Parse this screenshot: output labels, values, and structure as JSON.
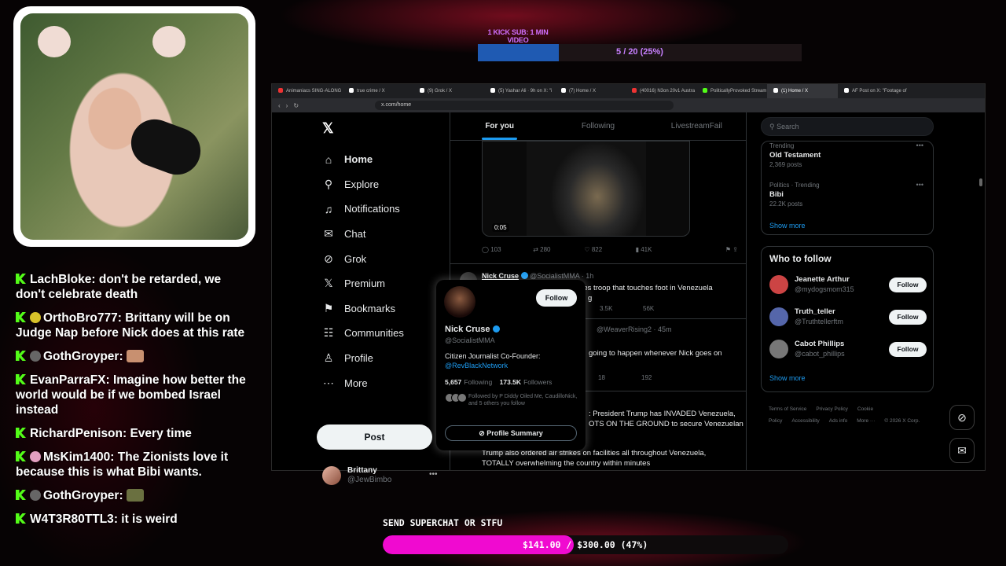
{
  "stream": {
    "subgoal": {
      "label": "1 KICK SUB: 1 MIN VIDEO",
      "progress_text": "5 / 20 (25%)",
      "progress": 0.25
    },
    "superchat": {
      "label": "SEND SUPERCHAT OR STFU",
      "progress_text": "$141.00 / $300.00 (47%)",
      "progress": 0.47
    }
  },
  "chat": [
    {
      "user": "LachBloke",
      "text": ": don't be retarded, we don't celebrate death",
      "badge": ""
    },
    {
      "user": "OrthoBro777",
      "text": ": Brittany will be on Judge Nap before Nick does at this rate",
      "badge": "#d8c22a"
    },
    {
      "user": "GothGroyper",
      "text": ":",
      "badge": "#666",
      "emote": "#c89070"
    },
    {
      "user": "EvanParraFX",
      "text": ": Imagine how better the world would be if we bombed Israel instead",
      "badge": ""
    },
    {
      "user": "RichardPenison",
      "text": ": Every time",
      "badge": ""
    },
    {
      "user": "MsKim1400",
      "text": ": The Zionists love it because this is what Bibi wants.",
      "badge": "#e2a0c0"
    },
    {
      "user": "GothGroyper",
      "text": ":",
      "badge": "#666",
      "emote": "#6a7040"
    },
    {
      "user": "W4T3R80TTL3",
      "text": ": it is weird",
      "badge": ""
    }
  ],
  "browser": {
    "tabs": [
      {
        "title": "Animaniacs SING-ALONG",
        "color": "#e33"
      },
      {
        "title": "true crime / X",
        "color": "#fff"
      },
      {
        "title": "(9) Grok / X",
        "color": "#fff"
      },
      {
        "title": "(5) Yashar Ali · 9h on X: \"i",
        "color": "#fff"
      },
      {
        "title": "(7) Home / X",
        "color": "#fff"
      },
      {
        "title": "(40016) N3on 20v1 Austra",
        "color": "#e33"
      },
      {
        "title": "PoliticallyProvoked Stream",
        "color": "#53fc18"
      },
      {
        "title": "(1) Home / X",
        "color": "#fff",
        "active": true
      },
      {
        "title": "AF Post on X: \"Footage of",
        "color": "#fff"
      }
    ],
    "url": "x.com/home"
  },
  "x": {
    "nav": [
      {
        "label": "Home",
        "icon": "home-icon",
        "glyph": "⌂",
        "active": true
      },
      {
        "label": "Explore",
        "icon": "search-icon",
        "glyph": "⚲"
      },
      {
        "label": "Notifications",
        "icon": "bell-icon",
        "glyph": "♫"
      },
      {
        "label": "Chat",
        "icon": "mail-icon",
        "glyph": "✉"
      },
      {
        "label": "Grok",
        "icon": "grok-icon",
        "glyph": "⊘"
      },
      {
        "label": "Premium",
        "icon": "x-premium-icon",
        "glyph": "𝕏"
      },
      {
        "label": "Bookmarks",
        "icon": "bookmark-icon",
        "glyph": "⚑"
      },
      {
        "label": "Communities",
        "icon": "communities-icon",
        "glyph": "☷"
      },
      {
        "label": "Profile",
        "icon": "profile-icon",
        "glyph": "♙"
      },
      {
        "label": "More",
        "icon": "more-icon",
        "glyph": "⋯"
      }
    ],
    "post_label": "Post",
    "me": {
      "name": "Brittany",
      "handle": "@JewBimbo"
    },
    "feed_tabs": [
      "For you",
      "Following",
      "LivestreamFail"
    ],
    "video": {
      "time": "0:05",
      "replies": "103",
      "reposts": "280",
      "likes": "822",
      "views": "41K"
    },
    "tweet1": {
      "name": "Nick Cruse",
      "handle": "@SocialistMMA · 1h",
      "text": "I hope every single United States troop that touches foot in Venezuela",
      "tail": "g",
      "likes": "3.5K",
      "views": "56K"
    },
    "tweet2": {
      "handle": "@WeaverRising2 · 45m",
      "text": "going to happen whenever Nick goes on",
      "likes": "18",
      "views": "192"
    },
    "tweet3": {
      "text": ": President Trump has INVADED Venezuela, OTS ON THE GROUND to secure Venezuelan",
      "text2": "Trump also ordered air strikes on facilities all throughout Venezuela, TOTALLY overwhelming the country within minutes"
    },
    "hovercard": {
      "follow": "Follow",
      "name": "Nick Cruse",
      "handle": "@SocialistMMA",
      "bio": "Citizen Journalist Co-Founder:",
      "bio_link": "@RevBlackNetwork",
      "following": "5,657",
      "following_label": "Following",
      "followers": "173.5K",
      "followers_label": "Followers",
      "followed_by": "Followed by P Diddy Oiled Me, CaudilloNick, and 5 others you follow",
      "summary": "Profile Summary"
    },
    "search_placeholder": "Search",
    "trends": [
      {
        "meta": "Trending",
        "title": "Old Testament",
        "count": "2,369 posts"
      },
      {
        "meta": "Politics · Trending",
        "title": "Bibi",
        "count": "22.2K posts"
      }
    ],
    "show_more": "Show more",
    "who_to_follow": {
      "title": "Who to follow",
      "people": [
        {
          "name": "Jeanette Arthur",
          "handle": "@mydogsmom315",
          "color": "#c44"
        },
        {
          "name": "Truth_teller",
          "handle": "@Truthtellerftm",
          "color": "#5566aa"
        },
        {
          "name": "Cabot Phillips",
          "handle": "@cabot_phillips",
          "color": "#777"
        }
      ],
      "follow": "Follow",
      "show_more": "Show more"
    },
    "footer": [
      "Terms of Service",
      "Privacy Policy",
      "Cookie Policy",
      "Accessibility",
      "Ads info",
      "More ···",
      "© 2026 X Corp."
    ]
  }
}
